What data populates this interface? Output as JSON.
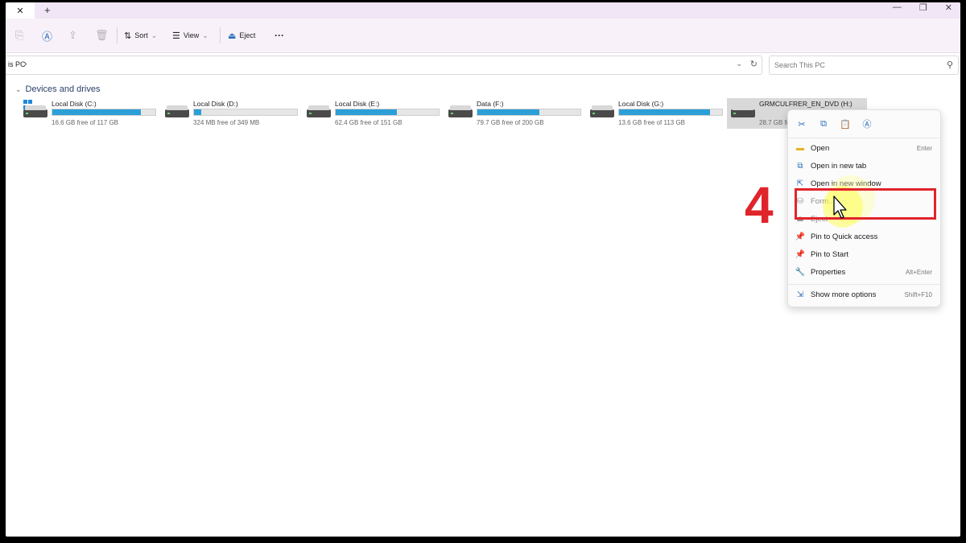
{
  "titlebar": {
    "tab_close": "✕",
    "new_tab": "+",
    "min": "—",
    "max": "❐",
    "close": "✕"
  },
  "toolbar": {
    "sort_label": "Sort",
    "view_label": "View",
    "eject_label": "Eject",
    "more_label": "···"
  },
  "address": {
    "path_text": "is PC",
    "chevron": "›"
  },
  "search": {
    "placeholder": "Search This PC"
  },
  "section": {
    "label": "Devices and drives",
    "chevron": "⌄"
  },
  "drives": [
    {
      "name": "Local Disk (C:)",
      "free_text": "16.6 GB free of 117 GB",
      "used_fraction": 0.86,
      "icon": "windows-drive-icon"
    },
    {
      "name": "Local Disk (D:)",
      "free_text": "324 MB free of 349 MB",
      "used_fraction": 0.07,
      "icon": "hdd-icon"
    },
    {
      "name": "Local Disk (E:)",
      "free_text": "62.4 GB free of 151 GB",
      "used_fraction": 0.59,
      "icon": "hdd-icon"
    },
    {
      "name": "Data (F:)",
      "free_text": "79.7 GB free of 200 GB",
      "used_fraction": 0.6,
      "icon": "hdd-icon"
    },
    {
      "name": "Local Disk (G:)",
      "free_text": "13.6 GB free of 113 GB",
      "used_fraction": 0.88,
      "icon": "hdd-icon"
    },
    {
      "name": "GRMCULFRER_EN_DVD (H:)",
      "free_text": "28.7 GB fre",
      "used_fraction": 0,
      "icon": "usb-drive-icon"
    }
  ],
  "context_menu": {
    "items": [
      {
        "label": "Open",
        "shortcut": "Enter"
      },
      {
        "label": "Open in new tab",
        "shortcut": ""
      },
      {
        "label": "Open in new window",
        "shortcut": ""
      },
      {
        "label": "Form...",
        "shortcut": ""
      },
      {
        "label": "Eject",
        "shortcut": ""
      },
      {
        "label": "Pin to Quick access",
        "shortcut": ""
      },
      {
        "label": "Pin to Start",
        "shortcut": ""
      },
      {
        "label": "Properties",
        "shortcut": "Alt+Enter"
      },
      {
        "label": "Show more options",
        "shortcut": "Shift+F10"
      }
    ]
  },
  "annotation": {
    "step_number": "4",
    "color": "#e0242b"
  },
  "colors": {
    "accent": "#2b9fd8",
    "titlebar": "#f1e6f5"
  }
}
